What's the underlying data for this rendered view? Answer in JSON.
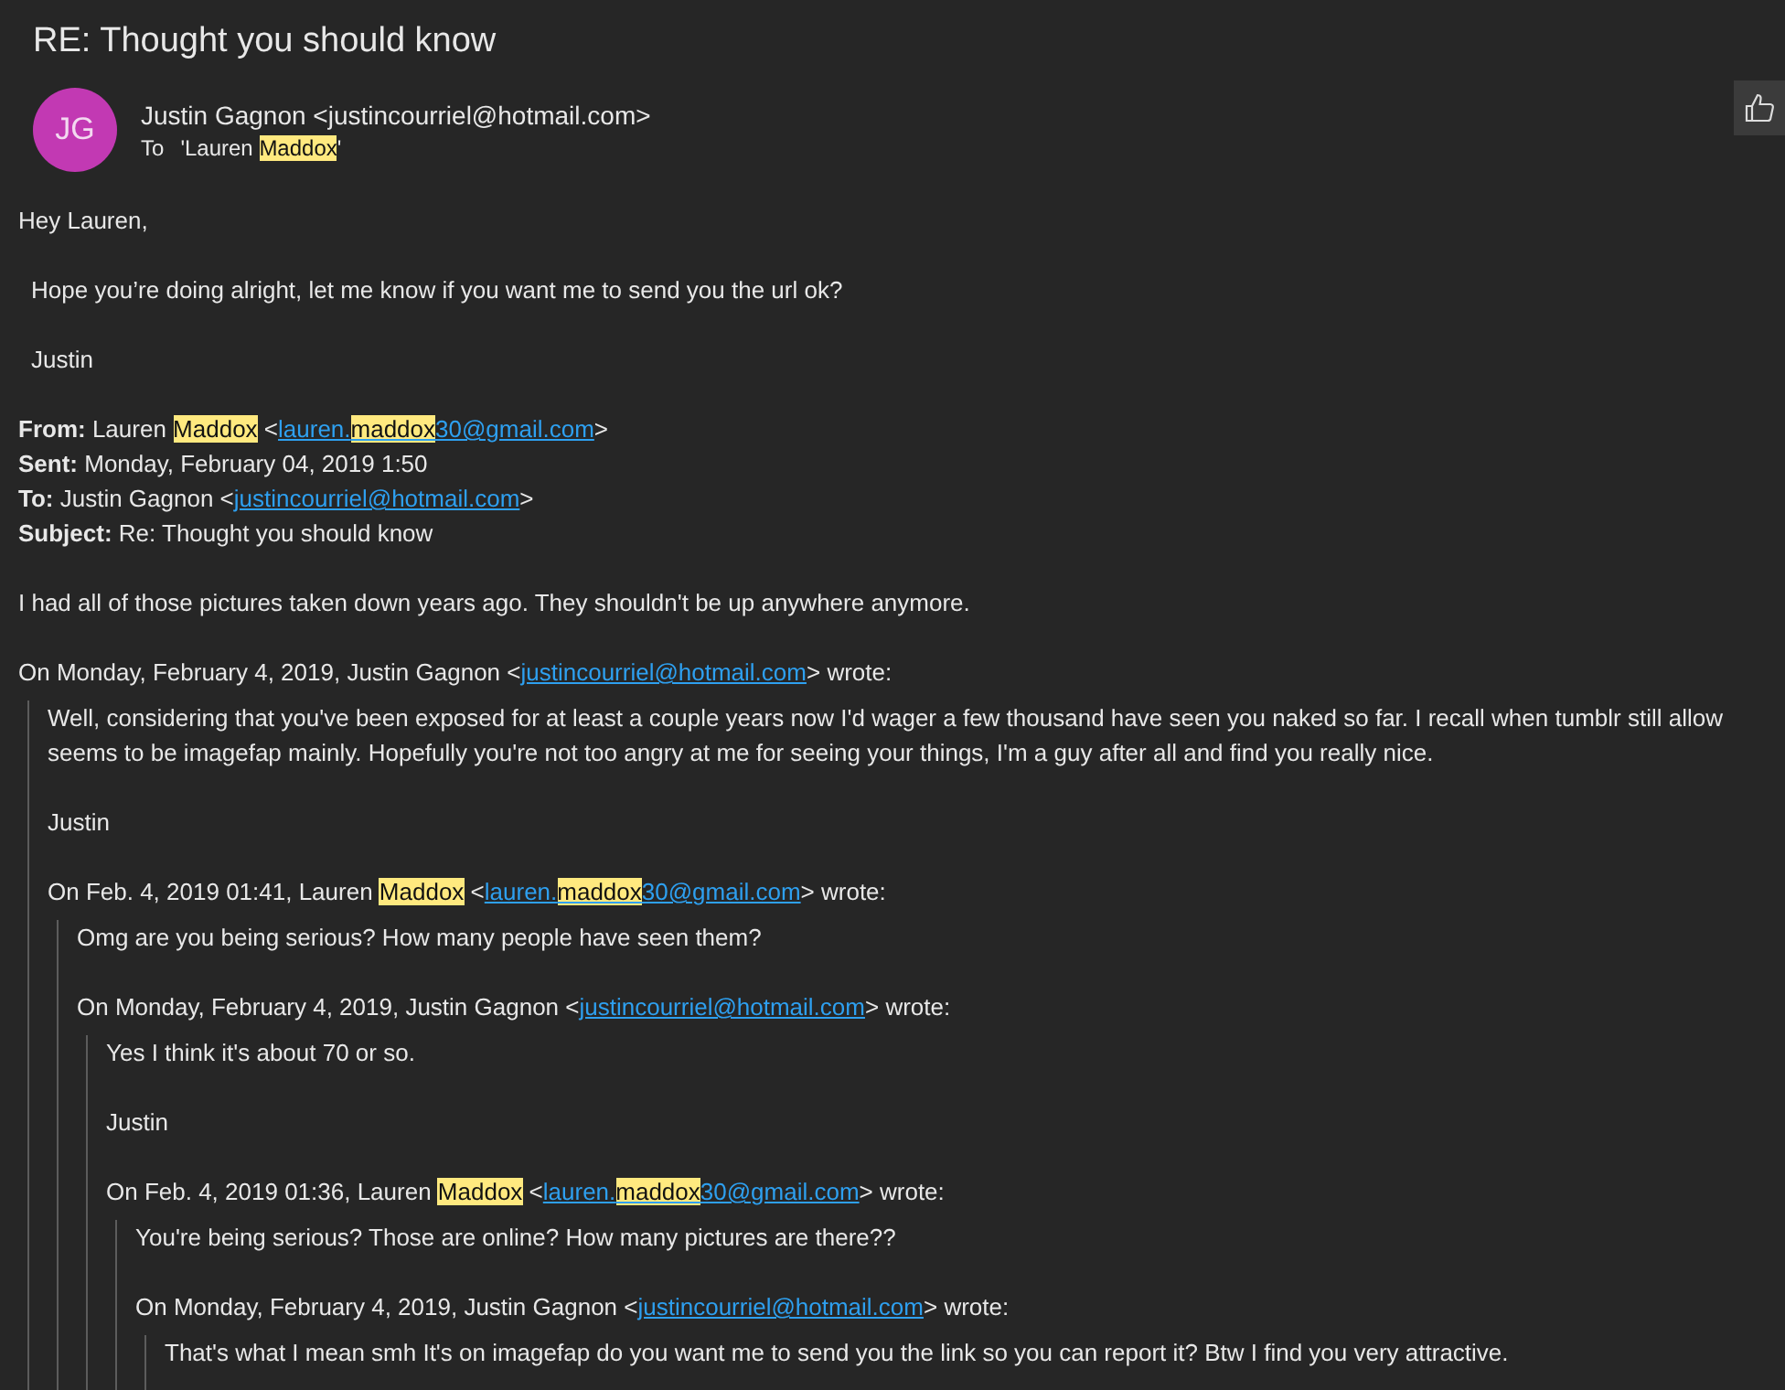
{
  "subject": "RE: Thought you should know",
  "sender": {
    "initials": "JG",
    "name": "Justin Gagnon <justincourriel@hotmail.com>"
  },
  "recipient": {
    "label": "To",
    "segments": [
      {
        "kind": "text",
        "t": "'Lauren "
      },
      {
        "kind": "highlight",
        "t": "Maddox"
      },
      {
        "kind": "text",
        "t": "'"
      }
    ]
  },
  "body": [
    {
      "kind": "text",
      "segs": [
        {
          "kind": "text",
          "t": "Hey Lauren,"
        }
      ]
    },
    {
      "kind": "text",
      "indent": true,
      "segs": [
        {
          "kind": "text",
          "t": "Hope you’re doing alright, let me know if you want me to send you the url ok?"
        }
      ]
    },
    {
      "kind": "text",
      "indent": true,
      "segs": [
        {
          "kind": "text",
          "t": "Justin"
        }
      ]
    },
    {
      "kind": "header",
      "lines": [
        [
          {
            "kind": "bold",
            "t": "From:"
          },
          {
            "kind": "text",
            "t": " Lauren "
          },
          {
            "kind": "highlight",
            "t": "Maddox"
          },
          {
            "kind": "text",
            "t": " <"
          },
          {
            "kind": "link",
            "parts": [
              {
                "t": "lauren.",
                "highlight": false
              },
              {
                "t": "maddox",
                "highlight": true
              },
              {
                "t": "30@gmail.com",
                "highlight": false
              }
            ]
          },
          {
            "kind": "text",
            "t": ">"
          }
        ],
        [
          {
            "kind": "bold",
            "t": "Sent:"
          },
          {
            "kind": "text",
            "t": " Monday, February 04, 2019 1:50"
          }
        ],
        [
          {
            "kind": "bold",
            "t": "To:"
          },
          {
            "kind": "text",
            "t": " Justin Gagnon <"
          },
          {
            "kind": "link",
            "parts": [
              {
                "t": "justincourriel@hotmail.com",
                "highlight": false
              }
            ]
          },
          {
            "kind": "text",
            "t": ">"
          }
        ],
        [
          {
            "kind": "bold",
            "t": "Subject:"
          },
          {
            "kind": "text",
            "t": " Re: Thought you should know"
          }
        ]
      ]
    },
    {
      "kind": "text",
      "segs": [
        {
          "kind": "text",
          "t": "I had all of those pictures taken down years ago. They shouldn't be up anywhere anymore."
        }
      ]
    },
    {
      "kind": "attribution",
      "segs": [
        {
          "kind": "text",
          "t": "On Monday, February 4, 2019, Justin Gagnon <"
        },
        {
          "kind": "link",
          "parts": [
            {
              "t": "justincourriel@hotmail.com",
              "highlight": false
            }
          ]
        },
        {
          "kind": "text",
          "t": "> wrote:"
        }
      ]
    },
    {
      "kind": "quote",
      "children": [
        {
          "kind": "text",
          "lines": [
            "Well, considering that you've been exposed for at least a couple years now I'd wager a few thousand have seen you naked so far. I recall when tumblr still allow",
            "seems to be imagefap mainly. Hopefully you're not too angry at me for seeing your things, I'm a guy after all and find you really nice."
          ]
        },
        {
          "kind": "text",
          "segs": [
            {
              "kind": "text",
              "t": "Justin"
            }
          ]
        },
        {
          "kind": "attribution",
          "segs": [
            {
              "kind": "text",
              "t": "On Feb. 4, 2019 01:41, Lauren "
            },
            {
              "kind": "highlight",
              "t": "Maddox"
            },
            {
              "kind": "text",
              "t": " <"
            },
            {
              "kind": "link",
              "parts": [
                {
                  "t": "lauren.",
                  "highlight": false
                },
                {
                  "t": "maddox",
                  "highlight": true
                },
                {
                  "t": "30@gmail.com",
                  "highlight": false
                }
              ]
            },
            {
              "kind": "text",
              "t": "> wrote:"
            }
          ]
        },
        {
          "kind": "quote",
          "children": [
            {
              "kind": "text",
              "segs": [
                {
                  "kind": "text",
                  "t": "Omg are you being serious? How many people have seen them?"
                }
              ]
            },
            {
              "kind": "attribution",
              "segs": [
                {
                  "kind": "text",
                  "t": "On Monday, February 4, 2019, Justin Gagnon <"
                },
                {
                  "kind": "link",
                  "parts": [
                    {
                      "t": "justincourriel@hotmail.com",
                      "highlight": false
                    }
                  ]
                },
                {
                  "kind": "text",
                  "t": "> wrote:"
                }
              ]
            },
            {
              "kind": "quote",
              "children": [
                {
                  "kind": "text",
                  "segs": [
                    {
                      "kind": "text",
                      "t": "Yes I think it's about 70 or so."
                    }
                  ]
                },
                {
                  "kind": "text",
                  "segs": [
                    {
                      "kind": "text",
                      "t": "Justin"
                    }
                  ]
                },
                {
                  "kind": "attribution",
                  "segs": [
                    {
                      "kind": "text",
                      "t": "On Feb. 4, 2019 01:36, Lauren "
                    },
                    {
                      "kind": "highlight",
                      "t": "Maddox"
                    },
                    {
                      "kind": "text",
                      "t": " <"
                    },
                    {
                      "kind": "link",
                      "parts": [
                        {
                          "t": "lauren.",
                          "highlight": false
                        },
                        {
                          "t": "maddox",
                          "highlight": true
                        },
                        {
                          "t": "30@gmail.com",
                          "highlight": false
                        }
                      ]
                    },
                    {
                      "kind": "text",
                      "t": "> wrote:"
                    }
                  ]
                },
                {
                  "kind": "quote",
                  "children": [
                    {
                      "kind": "text",
                      "segs": [
                        {
                          "kind": "text",
                          "t": "You're being serious? Those are online? How many pictures are there??"
                        }
                      ]
                    },
                    {
                      "kind": "attribution",
                      "segs": [
                        {
                          "kind": "text",
                          "t": "On Monday, February 4, 2019, Justin Gagnon <"
                        },
                        {
                          "kind": "link",
                          "parts": [
                            {
                              "t": "justincourriel@hotmail.com",
                              "highlight": false
                            }
                          ]
                        },
                        {
                          "kind": "text",
                          "t": "> wrote:"
                        }
                      ]
                    },
                    {
                      "kind": "quote",
                      "children": [
                        {
                          "kind": "text",
                          "segs": [
                            {
                              "kind": "text",
                              "t": "That's what I mean smh It's on imagefap do you want me to send you the link so you can report it? Btw I find you very attractive."
                            }
                          ]
                        }
                      ]
                    }
                  ]
                }
              ]
            }
          ]
        }
      ]
    }
  ]
}
